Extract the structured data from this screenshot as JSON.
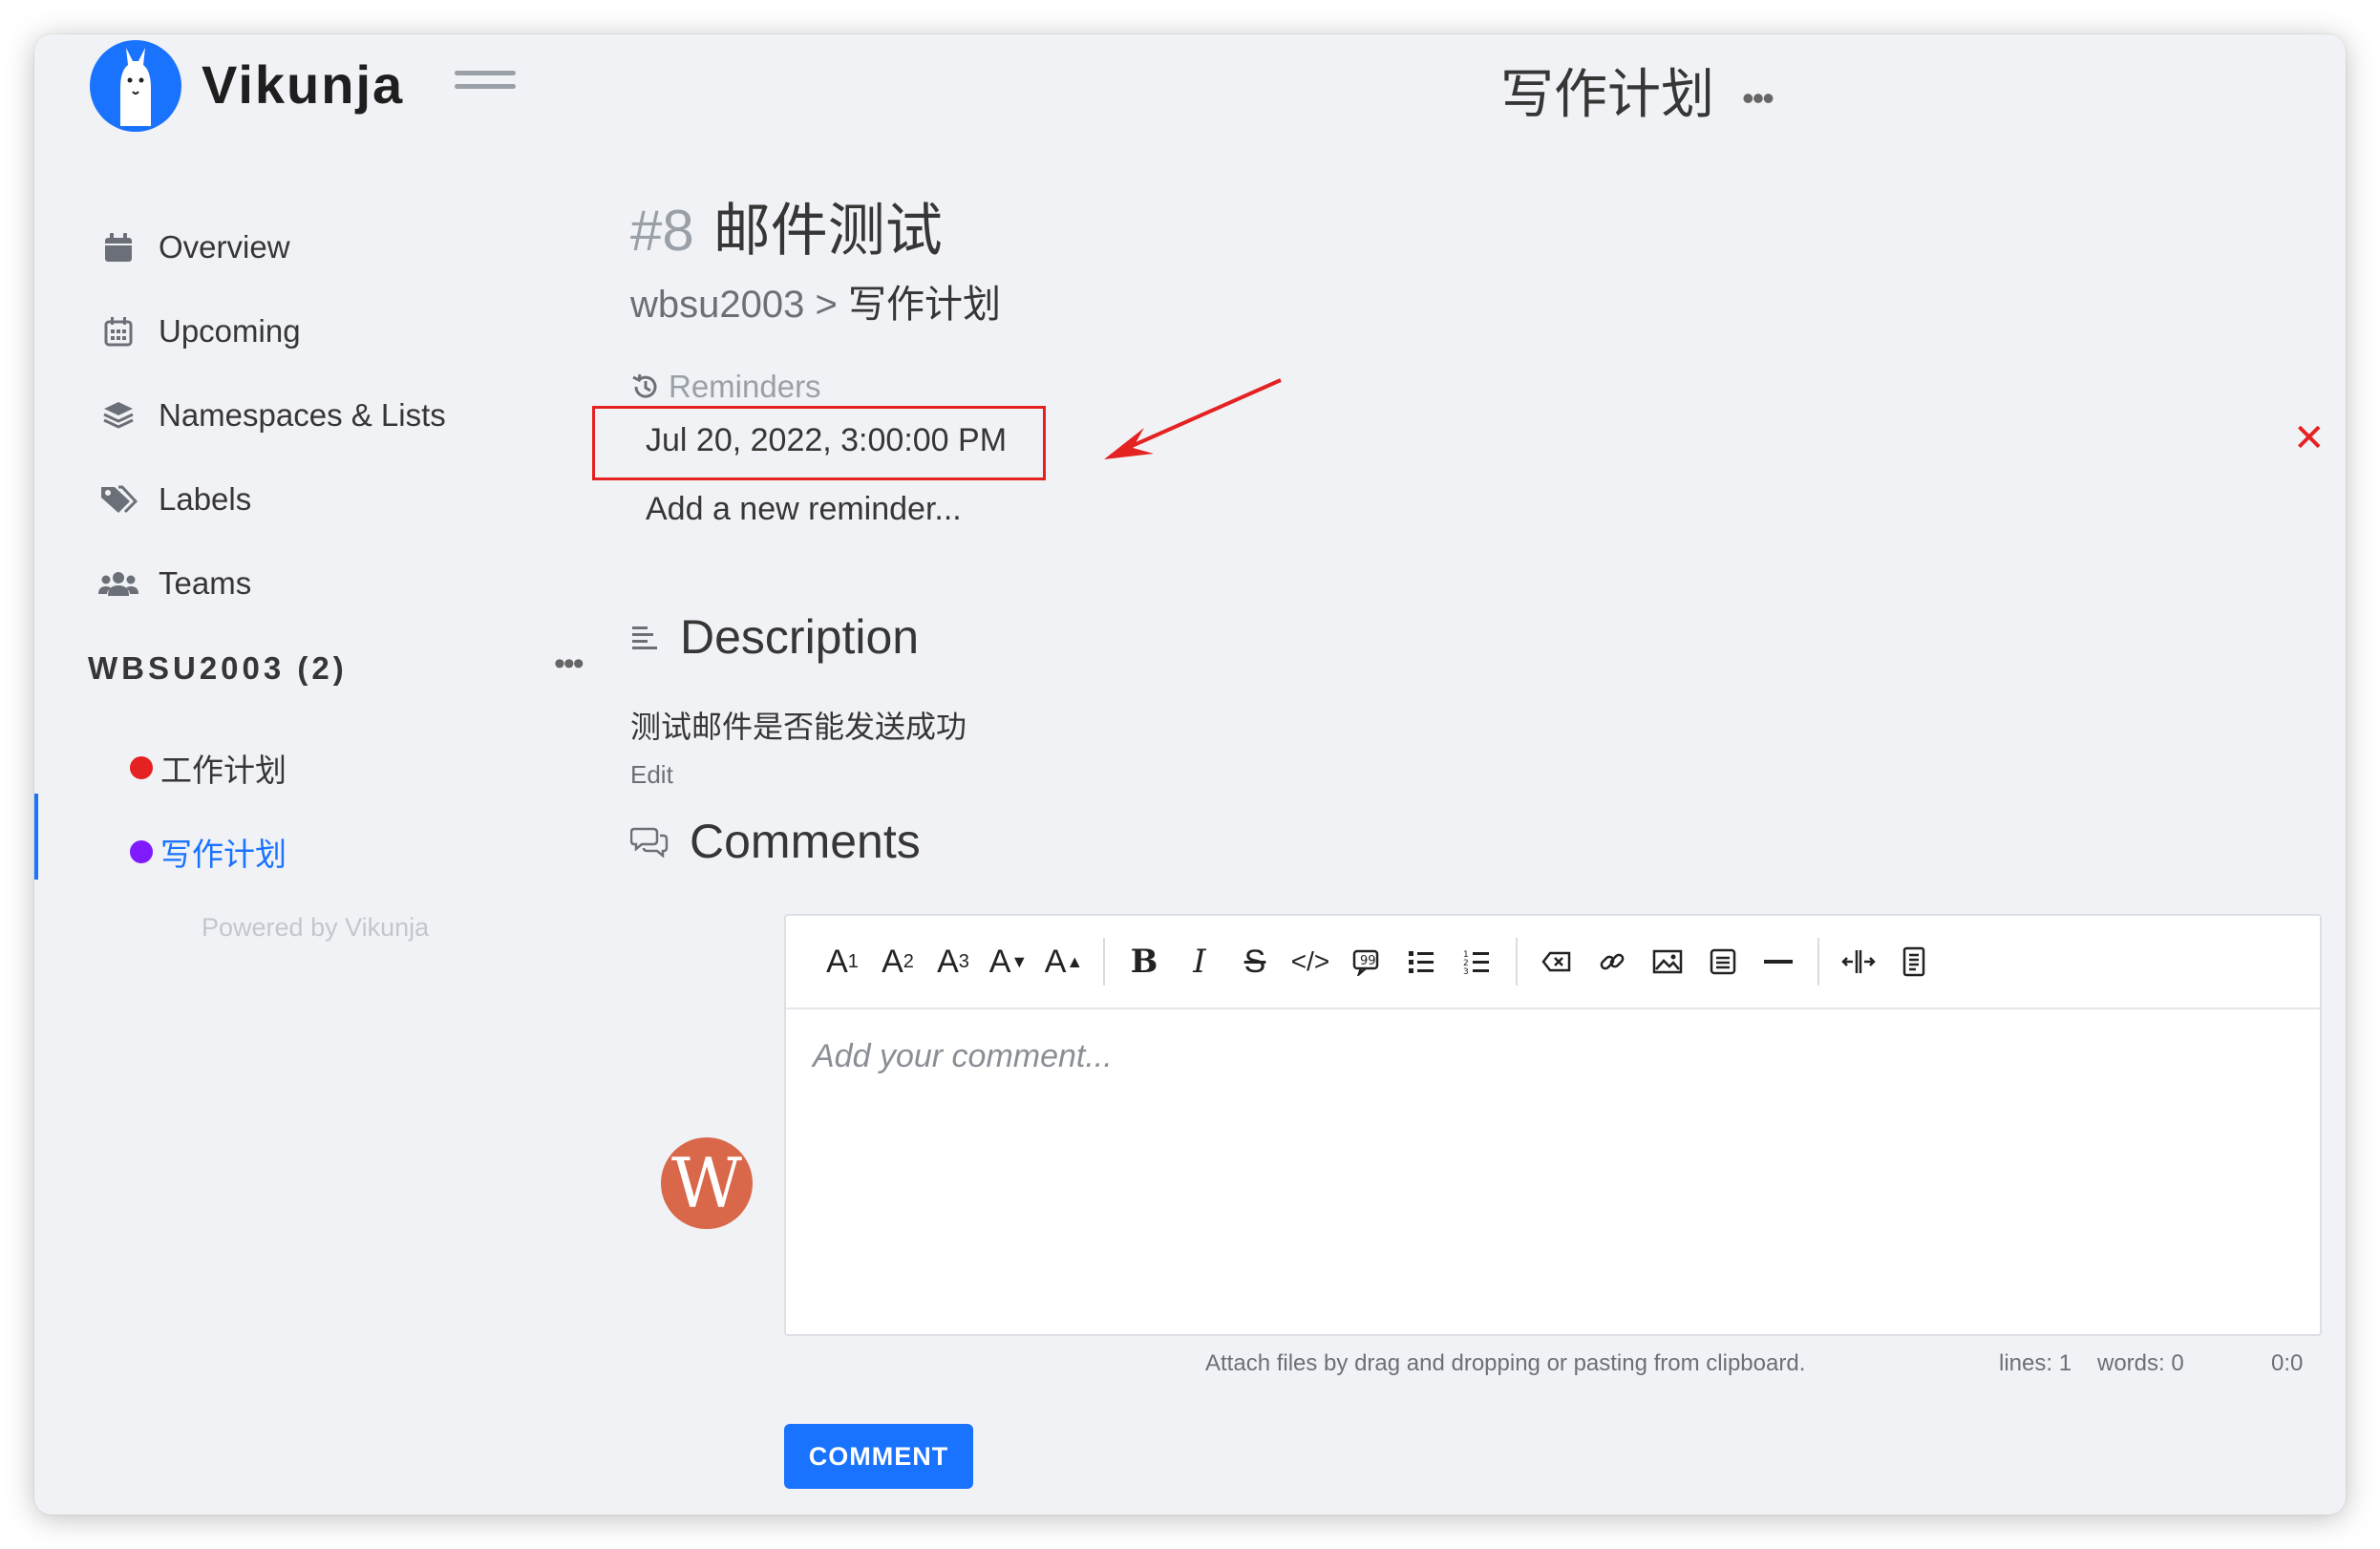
{
  "app": {
    "brand": "Vikunja"
  },
  "header": {
    "title": "写作计划",
    "more_glyph": "•••"
  },
  "sidebar": {
    "nav": [
      {
        "label": "Overview",
        "icon": "calendar-icon"
      },
      {
        "label": "Upcoming",
        "icon": "calendar-grid-icon"
      },
      {
        "label": "Namespaces & Lists",
        "icon": "layers-icon"
      },
      {
        "label": "Labels",
        "icon": "tags-icon"
      },
      {
        "label": "Teams",
        "icon": "users-icon"
      }
    ],
    "namespace": {
      "title": "WBSU2003 (2)",
      "more_glyph": "•••"
    },
    "lists": [
      {
        "label": "工作计划",
        "color": "#e52222",
        "active": false
      },
      {
        "label": "写作计划",
        "color": "#7f1aff",
        "active": true
      }
    ],
    "powered_by": "Powered by Vikunja"
  },
  "task": {
    "number": "#8",
    "title": "邮件测试",
    "breadcrumb_ns": "wbsu2003",
    "breadcrumb_sep": ">",
    "breadcrumb_list": "写作计划"
  },
  "reminders": {
    "label": "Reminders",
    "items": [
      "Jul 20, 2022, 3:00:00 PM"
    ],
    "add_label": "Add a new reminder...",
    "remove_glyph": "✕"
  },
  "description": {
    "heading": "Description",
    "text": "测试邮件是否能发送成功",
    "edit_label": "Edit"
  },
  "comments": {
    "heading": "Comments",
    "placeholder": "Add your comment...",
    "avatar_letter": "W",
    "attach_hint": "Attach files by drag and dropping or pasting from clipboard.",
    "lines": "lines: 1",
    "words": "words: 0",
    "cursor": "0:0",
    "submit_label": "COMMENT"
  },
  "colors": {
    "accent": "#1973ff",
    "danger": "#e52222",
    "avatar": "#d9674a"
  }
}
